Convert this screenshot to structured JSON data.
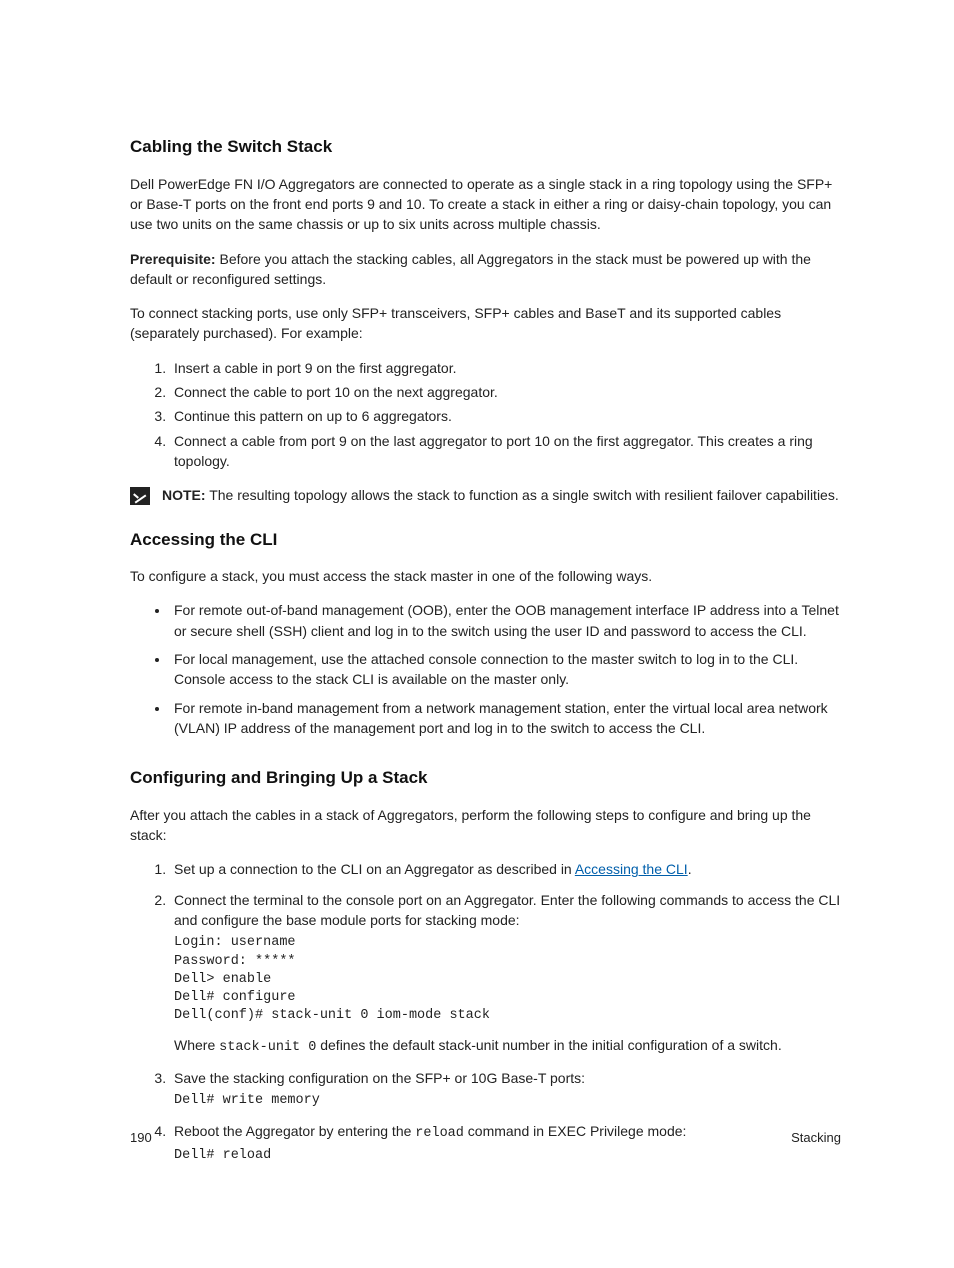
{
  "section1": {
    "heading": "Cabling the Switch Stack",
    "p1": "Dell PowerEdge FN I/O Aggregators are connected to operate as a single stack in a ring topology using the SFP+ or Base-T ports on the front end ports 9 and 10. To create a stack in either a ring or daisy-chain topology, you can use two units on the same chassis or up to six units across multiple chassis.",
    "p2_label": "Prerequisite:",
    "p2_text": " Before you attach the stacking cables, all Aggregators in the stack must be powered up with the default or reconfigured settings.",
    "p3": "To connect stacking ports, use only SFP+ transceivers, SFP+ cables and BaseT and its supported cables (separately purchased). For example:",
    "steps": [
      "Insert a cable in port 9 on the first aggregator.",
      "Connect the cable to port 10 on the next aggregator.",
      "Continue this pattern on up to 6 aggregators.",
      "Connect a cable from port 9 on the last aggregator to port 10 on the first aggregator. This creates a ring topology."
    ],
    "note_label": "NOTE:",
    "note_text": " The resulting topology allows the stack to function as a single switch with resilient failover capabilities."
  },
  "section2": {
    "heading": "Accessing the CLI",
    "p1": "To configure a stack, you must access the stack master in one of the following ways.",
    "bullets": [
      "For remote out-of-band management (OOB), enter the OOB management interface IP address into a Telnet or secure shell (SSH) client and log in to the switch using the user ID and password to access the CLI.",
      "For local management, use the attached console connection to the master switch to log in to the CLI. Console access to the stack CLI is available on the master only.",
      "For remote in-band management from a network management station, enter the virtual local area network (VLAN) IP address of the management port and log in to the switch to access the CLI."
    ]
  },
  "section3": {
    "heading": "Configuring and Bringing Up a Stack",
    "p1": "After you attach the cables in a stack of Aggregators, perform the following steps to configure and bring up the stack:",
    "step1_pre": "Set up a connection to the CLI on an Aggregator as described in ",
    "step1_link": "Accessing the CLI",
    "step1_post": ".",
    "step2_text": "Connect the terminal to the console port on an Aggregator. Enter the following commands to access the CLI and configure the base module ports for stacking mode:",
    "step2_code": "Login: username\nPassword: *****\nDell> enable\nDell# configure\nDell(conf)# stack-unit 0 iom-mode stack",
    "step2_where_pre": "Where ",
    "step2_where_code": "stack-unit 0",
    "step2_where_post": " defines the default stack-unit number in the initial configuration of a switch.",
    "step3_text": "Save the stacking configuration on the SFP+ or 10G Base-T ports:",
    "step3_code": "Dell# write memory",
    "step4_pre": "Reboot the Aggregator by entering the ",
    "step4_code_inline": "reload",
    "step4_post": " command in EXEC Privilege mode:",
    "step4_code": "Dell# reload"
  },
  "footer": {
    "page_number": "190",
    "chapter": "Stacking"
  }
}
